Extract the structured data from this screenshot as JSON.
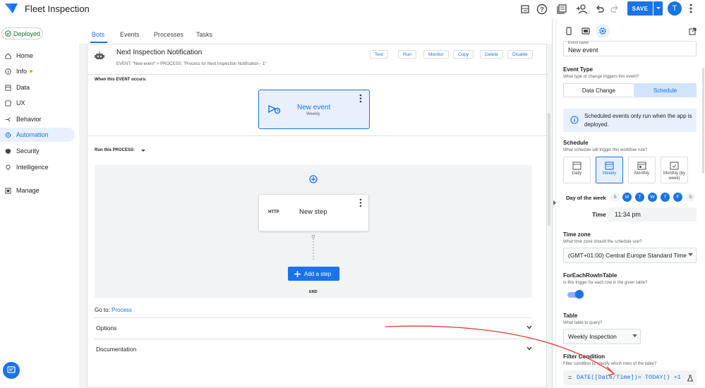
{
  "app": {
    "title": "Fleet Inspection"
  },
  "topbar": {
    "save_label": "SAVE",
    "avatar_initial": "T",
    "icons": [
      "table-icon",
      "help-icon",
      "docs-icon",
      "add-person-icon",
      "undo-icon",
      "redo-icon",
      "chevron-down-icon",
      "more-vert-icon"
    ]
  },
  "sidebar": {
    "status": "Deployed",
    "items": [
      {
        "label": "Home",
        "icon": "home-icon"
      },
      {
        "label": "Info",
        "icon": "info-icon"
      },
      {
        "label": "Data",
        "icon": "data-icon"
      },
      {
        "label": "UX",
        "icon": "ux-icon"
      },
      {
        "label": "Behavior",
        "icon": "behavior-icon"
      },
      {
        "label": "Automation",
        "icon": "automation-icon",
        "active": true
      },
      {
        "label": "Security",
        "icon": "security-icon"
      },
      {
        "label": "Intelligence",
        "icon": "intelligence-icon"
      },
      {
        "label": "Manage",
        "icon": "manage-icon"
      }
    ]
  },
  "main": {
    "tabs": [
      "Bots",
      "Events",
      "Processes",
      "Tasks"
    ],
    "active_tab": "Bots",
    "bot": {
      "title": "Next Inspection Notification",
      "subtitle": "EVENT: \"New event\" > PROCESS: \"Process for Next Inspection Notification - 1\"",
      "actions": [
        "Test",
        "Run",
        "Monitor",
        "Copy",
        "Delete",
        "Disable"
      ]
    },
    "event_section": "When this EVENT occurs:",
    "event": {
      "title": "New event",
      "subtitle": "Weekly"
    },
    "process_section": "Run this PROCESS:",
    "step": {
      "type": "HTTP",
      "title": "New step"
    },
    "add_step_label": "Add a step",
    "end_label": "END",
    "goto_prefix": "Go to:",
    "goto_link": "Process",
    "accordions": [
      "Options",
      "Documentation"
    ]
  },
  "panel": {
    "event_name_label": "Event name",
    "event_name_value": "New event",
    "event_type": {
      "label": "Event Type",
      "hint": "What type of change triggers this event?",
      "options": [
        "Data Change",
        "Schedule"
      ],
      "selected": "Schedule"
    },
    "info_text": "Scheduled events only run when the app is deployed.",
    "schedule": {
      "label": "Schedule",
      "hint": "What schedule will trigger this workflow rule?",
      "options": [
        {
          "label": "Daily"
        },
        {
          "label": "Weekly",
          "active": true
        },
        {
          "label": "Monthly"
        },
        {
          "label": "Monthly (by week)"
        }
      ]
    },
    "day_of_week": {
      "label": "Day of the week",
      "days": [
        {
          "l": "S",
          "on": false
        },
        {
          "l": "M",
          "on": true
        },
        {
          "l": "T",
          "on": true
        },
        {
          "l": "W",
          "on": true
        },
        {
          "l": "T",
          "on": true
        },
        {
          "l": "F",
          "on": true
        },
        {
          "l": "S",
          "on": false
        }
      ]
    },
    "time": {
      "label": "Time",
      "value": "11:34 pm"
    },
    "timezone": {
      "label": "Time zone",
      "hint": "What time zone should the schedule use?",
      "value": "(GMT+01:00) Central Europe Standard Time"
    },
    "for_each_row": {
      "label": "ForEachRowInTable",
      "hint": "Is this trigger for each row in the given table?",
      "enabled": true
    },
    "table": {
      "label": "Table",
      "hint": "What table to query?",
      "value": "Weekly Inspection"
    },
    "filter": {
      "label": "Filter Condition",
      "hint": "Filter condition to specify which rows of the table?",
      "prefix": "=",
      "value": "DATE([Date/Time])= TODAY() +1"
    }
  },
  "colors": {
    "accent": "#1a73e8",
    "annotation": "#e53935",
    "deployed": "#137333"
  }
}
